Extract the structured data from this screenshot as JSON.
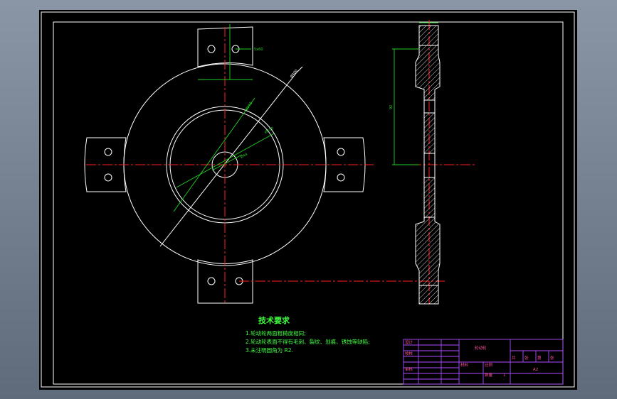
{
  "drawing": {
    "tech_title": "技术要求",
    "tech_notes": [
      "1.轮动轮两面粗糙度相同;",
      "2.轮动轮表面不得有毛刺、裂纹、划痕、锈蚀等缺陷;",
      "3.未注明圆角为 R2."
    ],
    "dim_top_tab": "5x60",
    "dim_diag_outer": "Ø400",
    "dim_diag_mid": "Ø258",
    "dim_diag_inner": "Ø150",
    "dim_hub": "Ø44",
    "dim_side_height": "92",
    "title_block": {
      "part_name": "轮动轮",
      "row_labels": [
        "设计",
        "校核",
        "审核"
      ],
      "mid_labels": [
        "材料",
        "比例"
      ],
      "scale_label": "数量",
      "scale_value": "1",
      "sheet_info": [
        "共",
        "张",
        "第",
        "张"
      ],
      "sheet_size": "A2"
    },
    "colors": {
      "background": "#000000",
      "geometry": "#ffffff",
      "centerline": "#ff2020",
      "dimension": "#22d022",
      "note_text": "#40ff40",
      "hatch": "#ffffff",
      "title_block_lines": "#b04cff",
      "title_block_text": "#ff50a0"
    }
  }
}
